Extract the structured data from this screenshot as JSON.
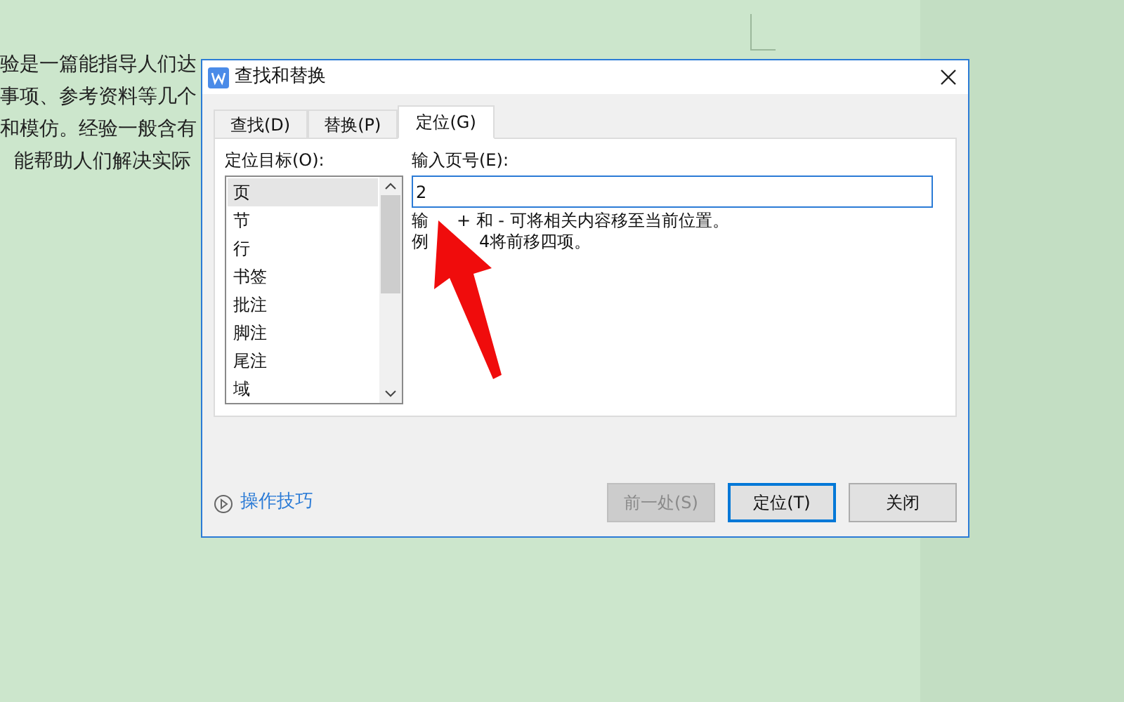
{
  "document": {
    "lines": [
      {
        "text": "验是一篇能指导人们达",
        "indent": false
      },
      {
        "text": "事项、参考资料等几个",
        "indent": false
      },
      {
        "text": "和模仿。经验一般含有",
        "indent": false
      },
      {
        "text": "能帮助人们解决实际",
        "indent": true
      }
    ]
  },
  "dialog": {
    "title": "查找和替换",
    "tabs": [
      {
        "label": "查找(D)",
        "selected": false
      },
      {
        "label": "替换(P)",
        "selected": false
      },
      {
        "label": "定位(G)",
        "selected": true
      }
    ],
    "target_label": "定位目标(O):",
    "targets": [
      {
        "label": "页",
        "selected": true
      },
      {
        "label": "节",
        "selected": false
      },
      {
        "label": "行",
        "selected": false
      },
      {
        "label": "书签",
        "selected": false
      },
      {
        "label": "批注",
        "selected": false
      },
      {
        "label": "脚注",
        "selected": false
      },
      {
        "label": "尾注",
        "selected": false
      },
      {
        "label": "域",
        "selected": false
      }
    ],
    "input_label": "输入页号(E):",
    "input_value": "2",
    "hint_lines": [
      [
        "输",
        "+ 和 - 可将相关内容移至当前位置。"
      ],
      [
        "例",
        "4将前移四项。"
      ]
    ],
    "tips_link": "操作技巧",
    "buttons": [
      {
        "label": "前一处(S)",
        "disabled": true,
        "default": false
      },
      {
        "label": "定位(T)",
        "disabled": false,
        "default": true
      },
      {
        "label": "关闭",
        "disabled": false,
        "default": false
      }
    ]
  }
}
